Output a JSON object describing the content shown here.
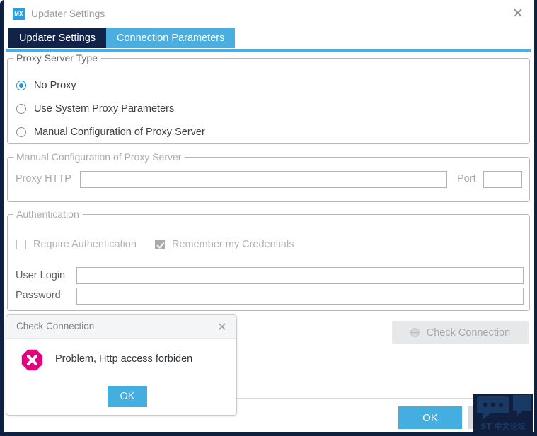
{
  "window": {
    "title": "Updater Settings",
    "app_icon_text": "MX",
    "close_label": "✕",
    "accent_color": "#4aafe0",
    "chrome_color": "#0e2141"
  },
  "tabs": [
    {
      "label": "Updater Settings",
      "active": false
    },
    {
      "label": "Connection Parameters",
      "active": true
    }
  ],
  "proxy_server_type": {
    "group_title": "Proxy Server Type",
    "options": [
      {
        "label": "No Proxy",
        "selected": true
      },
      {
        "label": "Use System Proxy Parameters",
        "selected": false
      },
      {
        "label": "Manual Configuration of Proxy Server",
        "selected": false
      }
    ]
  },
  "manual_config": {
    "group_title": "Manual Configuration of Proxy Server",
    "proxy_http_label": "Proxy HTTP",
    "proxy_http_value": "",
    "port_label": "Port",
    "port_value": ""
  },
  "authentication": {
    "group_title": "Authentication",
    "require_auth": {
      "label": "Require Authentication",
      "checked": false
    },
    "remember_credentials": {
      "label": "Remember my Credentials",
      "checked": true
    },
    "user_login_label": "User Login",
    "user_login_value": "",
    "password_label": "Password",
    "password_value": ""
  },
  "actions": {
    "check_connection_label": "Check Connection",
    "check_connection_icon": "globe-icon",
    "ok_label": "OK",
    "cancel_label": ""
  },
  "dialog": {
    "title": "Check Connection",
    "close_label": "✕",
    "message": "Problem, Http access forbiden",
    "ok_label": "OK",
    "icon": "error-octagon-icon",
    "icon_color": "#E6007E"
  },
  "watermark": {
    "text": "ST 中文论坛",
    "color": "#0f1f3d"
  }
}
